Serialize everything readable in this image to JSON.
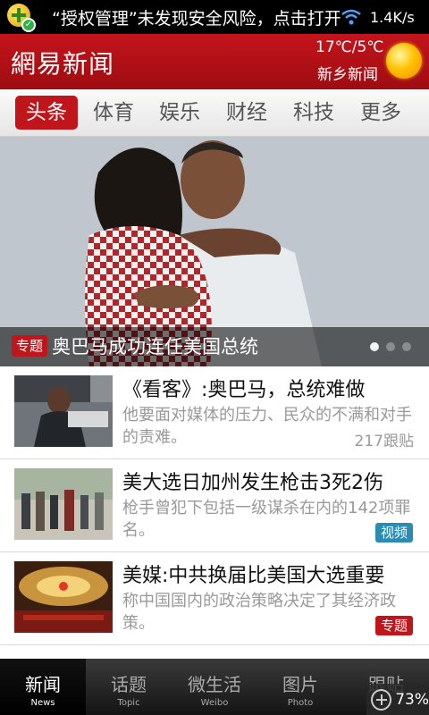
{
  "status_bar": {
    "notification_text": "“授权管理”未发现安全风险，点击打开",
    "net_speed": "1.4K/s"
  },
  "header": {
    "logo": "網易新闻",
    "weather_temp": "17℃/5℃",
    "weather_city": "新乡新闻"
  },
  "tabs": [
    {
      "label": "头条",
      "active": true
    },
    {
      "label": "体育"
    },
    {
      "label": "娱乐"
    },
    {
      "label": "财经"
    },
    {
      "label": "科技"
    },
    {
      "label": "更多"
    }
  ],
  "hero": {
    "badge": "专题",
    "title": "奥巴马成功连任美国总统",
    "slide_count": 3,
    "active_slide": 1
  },
  "news": [
    {
      "title": "《看客》:奥巴马，总统难做",
      "desc": "他要面对媒体的压力、民众的不满和对手的责难。",
      "meta": "217跟贴"
    },
    {
      "title": "美大选日加州发生枪击3死2伤",
      "desc": "枪手曾犯下包括一级谋杀在内的142项罪名。",
      "tag": "视频"
    },
    {
      "title": "美媒:中共换届比美国大选重要",
      "desc": "称中国国内的政治策略决定了其经济政策。",
      "tag": "专题"
    }
  ],
  "bottom_bar": [
    {
      "cn": "新闻",
      "en": "News",
      "active": true
    },
    {
      "cn": "话题",
      "en": "Topic"
    },
    {
      "cn": "微生活",
      "en": "Weibo"
    },
    {
      "cn": "图片",
      "en": "Photo"
    },
    {
      "cn": "跟贴",
      "en": ""
    }
  ],
  "overlay": {
    "percent": "73%"
  },
  "colors": {
    "brand_red": "#c0151b",
    "tag_blue": "#2a8bb5"
  }
}
